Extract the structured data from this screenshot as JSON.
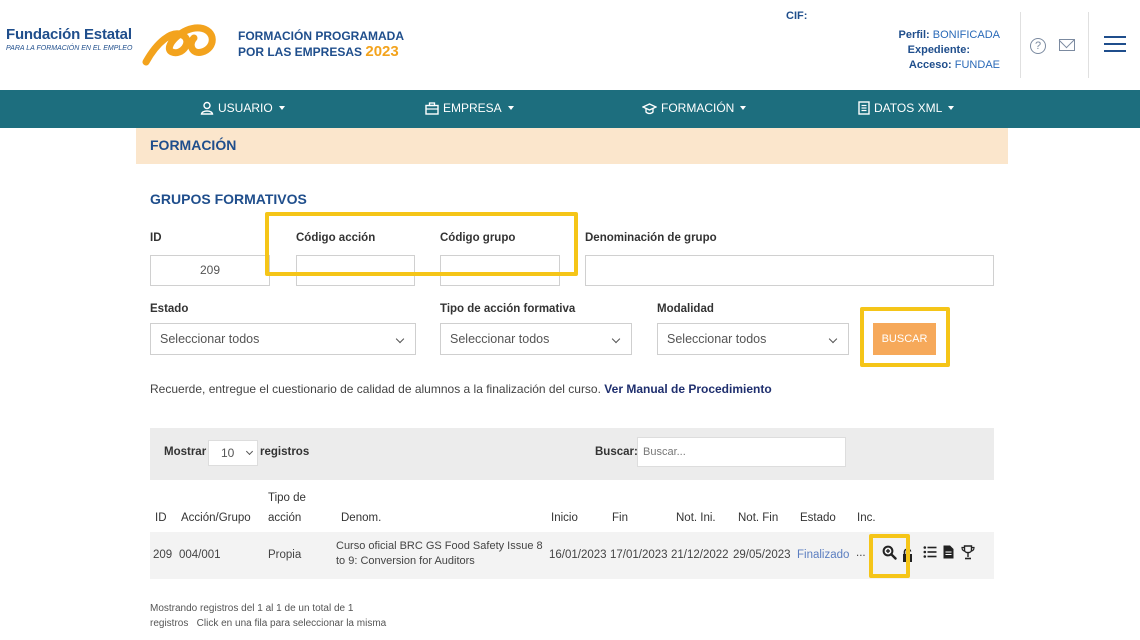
{
  "header": {
    "brand_title": "Fundación Estatal",
    "brand_sub": "PARA LA FORMACIÓN EN EL EMPLEO",
    "program_line1": "FORMACIÓN PROGRAMADA",
    "program_line2": "POR LAS EMPRESAS",
    "program_year": "2023",
    "cif_label": "CIF:",
    "perfil_label": "Perfil:",
    "perfil_value": "BONIFICADA",
    "expediente_label": "Expediente:",
    "acceso_label": "Acceso:",
    "acceso_value": "FUNDAE",
    "help_glyph": "?"
  },
  "nav": {
    "usuario": "USUARIO",
    "empresa": "EMPRESA",
    "formacion": "FORMACIÓN",
    "datos_xml": "DATOS XML"
  },
  "section": {
    "title": "FORMACIÓN"
  },
  "form": {
    "subtitle": "GRUPOS FORMATIVOS",
    "id_label": "ID",
    "id_value": "209",
    "codigo_accion_label": "Código acción",
    "codigo_grupo_label": "Código grupo",
    "denominacion_label": "Denominación de grupo",
    "estado_label": "Estado",
    "estado_value": "Seleccionar todos",
    "tipo_label": "Tipo de acción formativa",
    "tipo_value": "Seleccionar todos",
    "modalidad_label": "Modalidad",
    "modalidad_value": "Seleccionar todos",
    "buscar_button": "BUSCAR"
  },
  "notice": {
    "text": "Recuerde, entregue el cuestionario de calidad de alumnos a la finalización del curso.",
    "link": "Ver Manual de Procedimiento"
  },
  "table": {
    "mostrar": "Mostrar",
    "page_size": "10",
    "registros": "registros",
    "buscar_label": "Buscar:",
    "buscar_placeholder": "Buscar...",
    "headers": {
      "id": "ID",
      "accion_grupo": "Acción/Grupo",
      "tipo_l1": "Tipo de",
      "tipo_l2": "acción",
      "denom": "Denom.",
      "inicio": "Inicio",
      "fin": "Fin",
      "not_ini": "Not. Ini.",
      "not_fin": "Not. Fin",
      "estado": "Estado",
      "inc": "Inc."
    },
    "row": {
      "id": "209",
      "accion_grupo": "004/001",
      "tipo": "Propia",
      "denom_l1": "Curso oficial BRC GS Food Safety Issue 8",
      "denom_l2": "to 9: Conversion for Auditors",
      "inicio": "16/01/2023",
      "fin": "17/01/2023",
      "not_ini": "21/12/2022",
      "not_fin": "29/05/2023",
      "estado": "Finalizado",
      "inc": "..."
    },
    "icons": [
      "magnify-plus-icon",
      "lock-icon",
      "list-icon",
      "document-icon",
      "trophy-icon"
    ]
  },
  "footer": {
    "line1": "Mostrando registros del 1 al 1 de un total de 1",
    "line2": "registros   Click en una fila para seleccionar la misma"
  },
  "colors": {
    "nav_bg": "#1d6e7e",
    "section_bg": "#fbe6cc",
    "accent_orange": "#f6a95a",
    "highlight": "#f5c518",
    "brand_blue": "#1f4e8c"
  }
}
